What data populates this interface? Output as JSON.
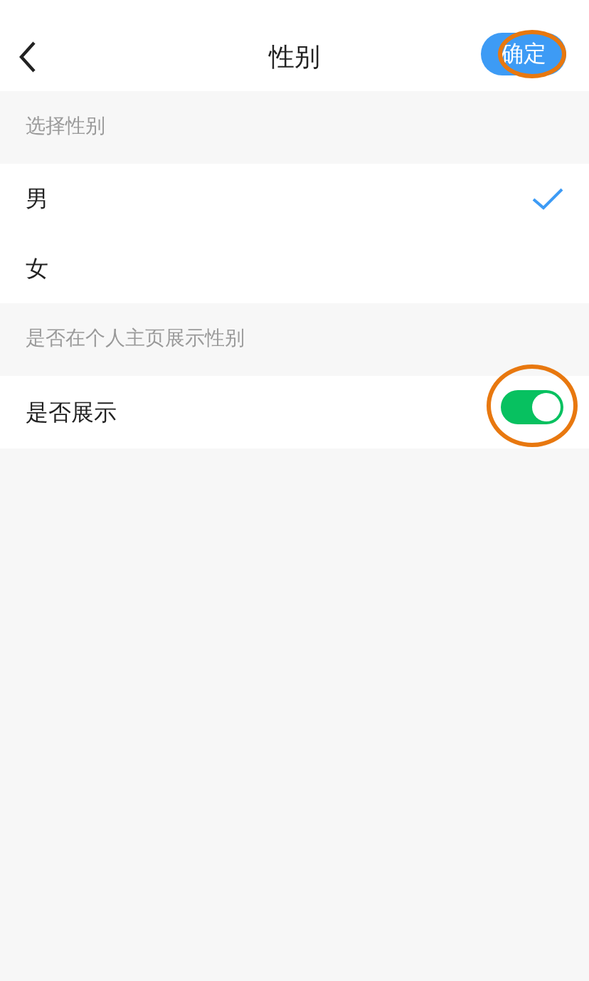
{
  "header": {
    "title": "性别",
    "confirm": {
      "label": "确定",
      "highlighted": true
    }
  },
  "sections": [
    {
      "label": "选择性别",
      "options": [
        {
          "label": "男",
          "selected": true
        },
        {
          "label": "女",
          "selected": false
        }
      ]
    },
    {
      "label": "是否在个人主页展示性别",
      "toggles": [
        {
          "label": "是否展示",
          "on": true,
          "highlighted": true
        }
      ]
    }
  ]
}
